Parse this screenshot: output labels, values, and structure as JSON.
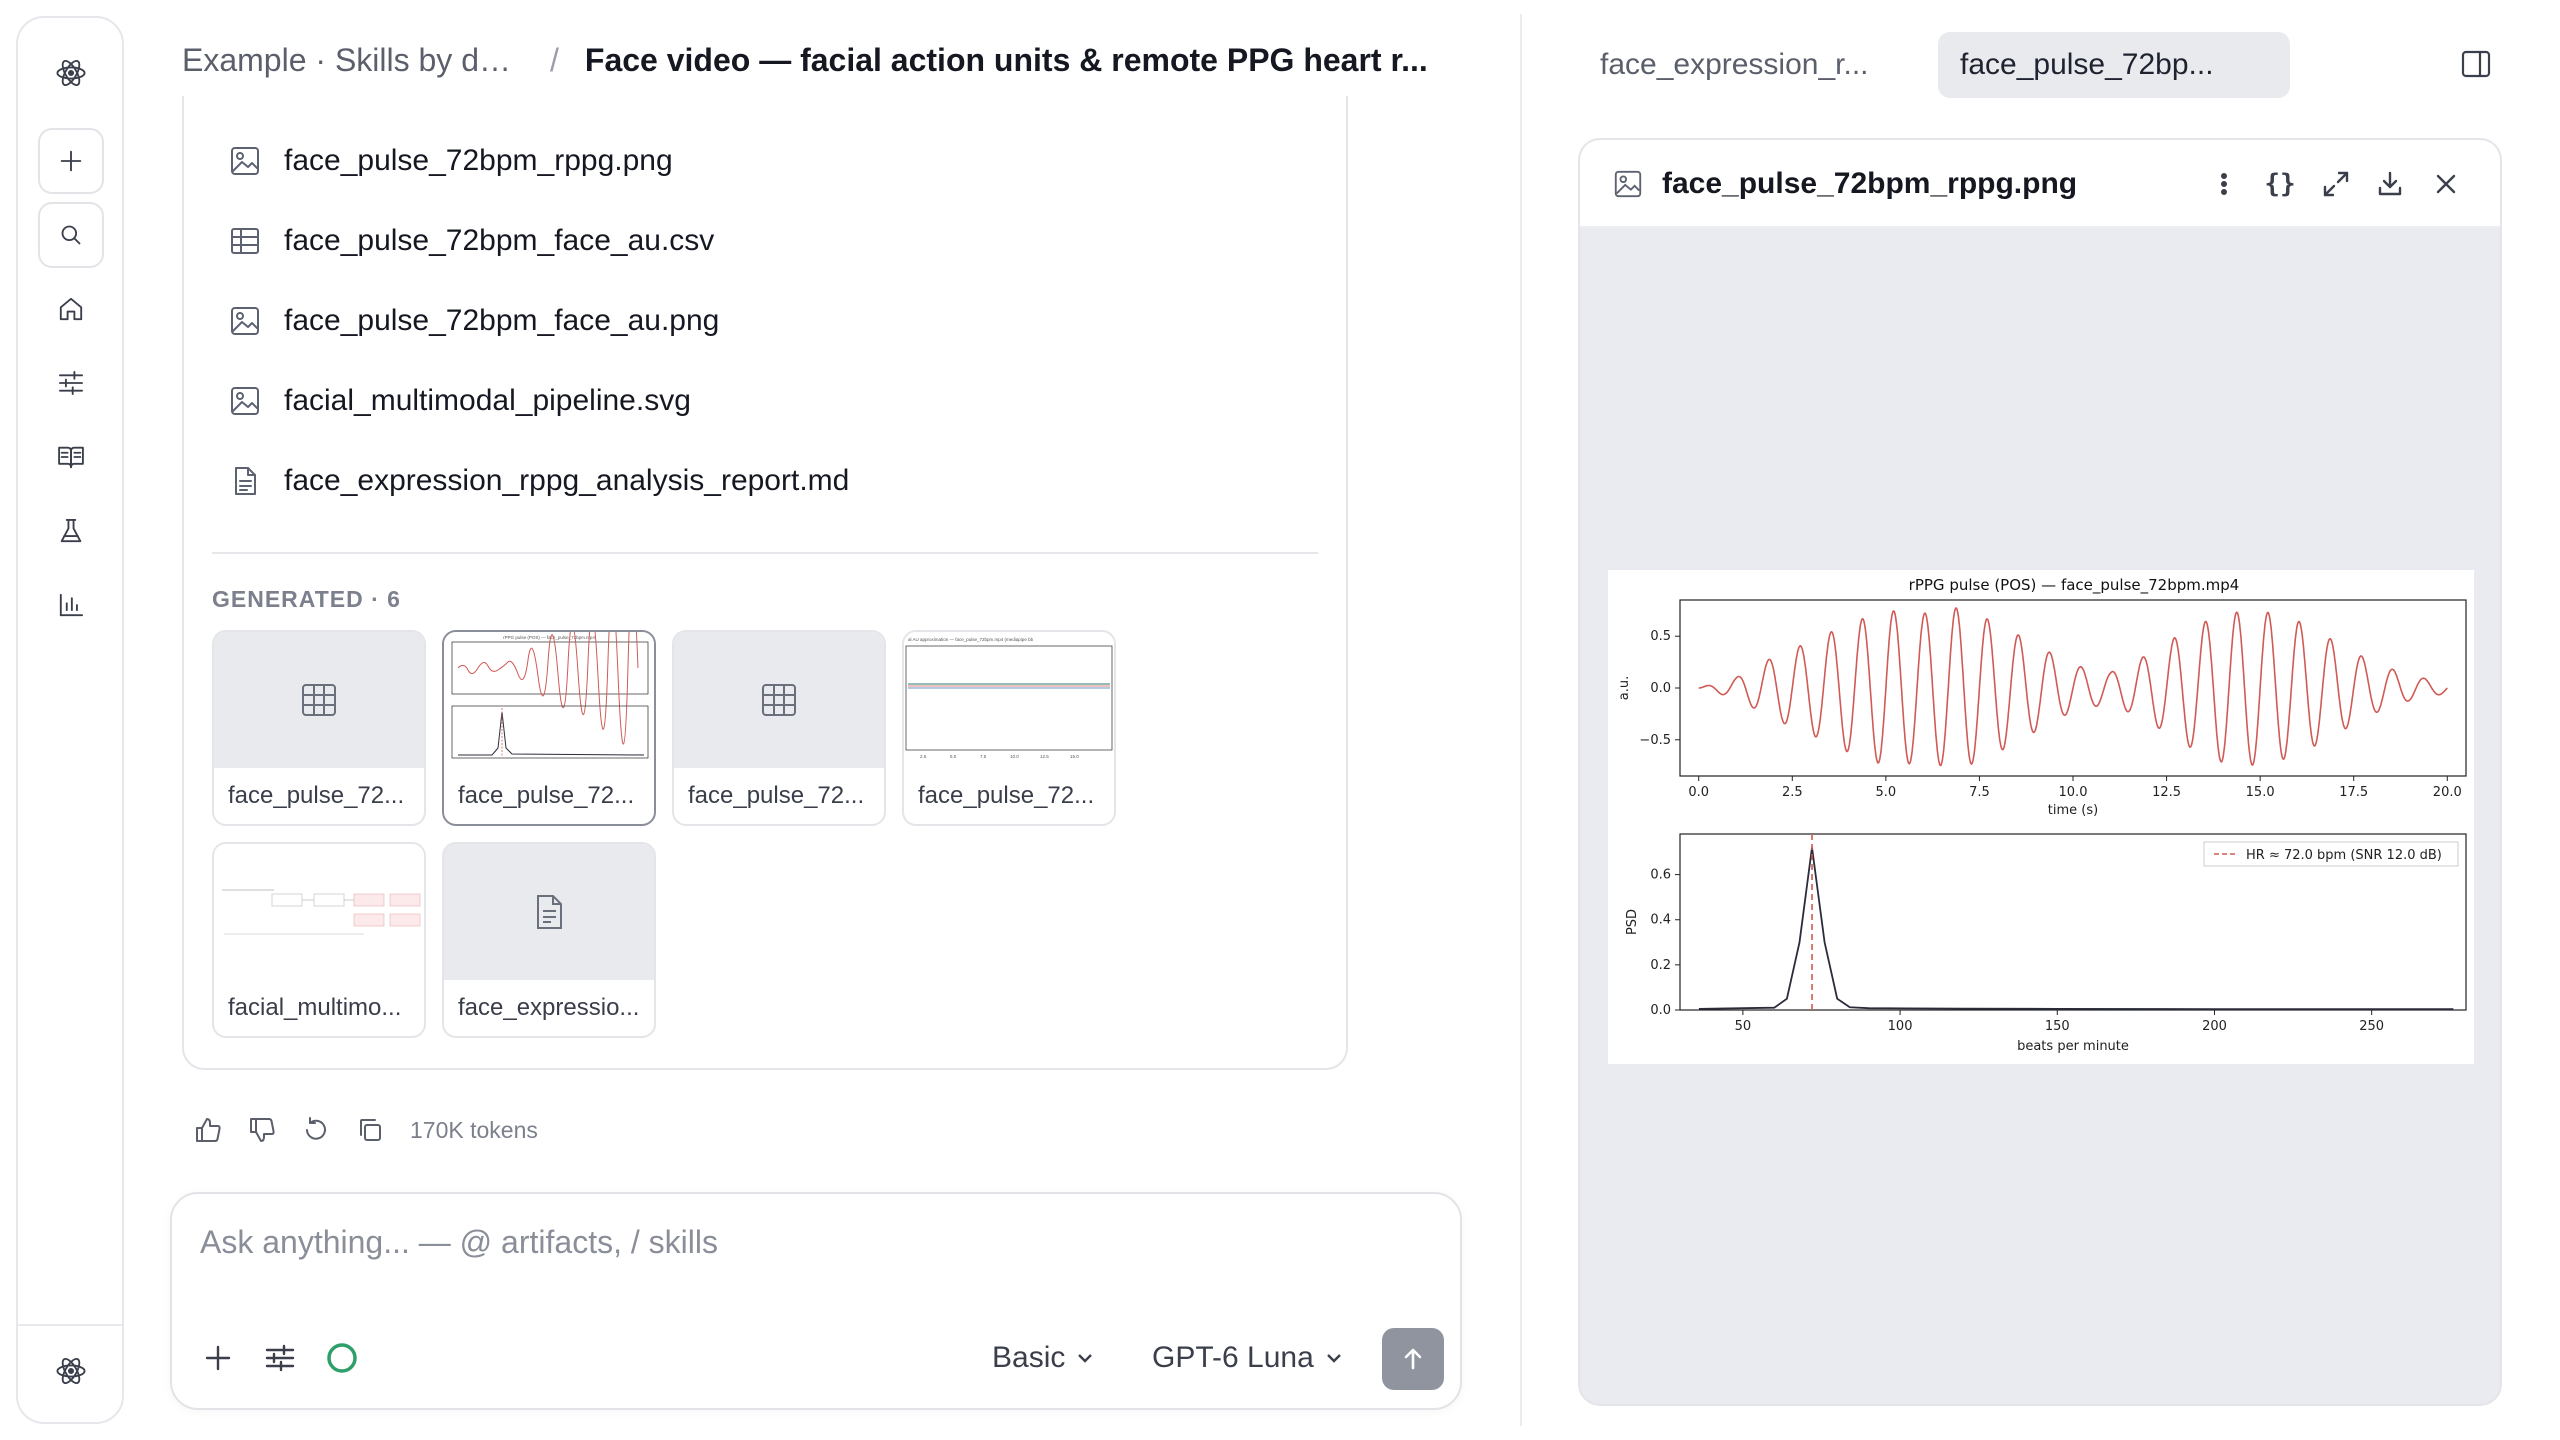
{
  "header": {
    "breadcrumb_parent": "Example · Skills by do...",
    "breadcrumb_separator": "/",
    "title": "Face video — facial action units & remote PPG heart r..."
  },
  "files": [
    {
      "name": "face_pulse_72bpm_rppg.png",
      "icon": "image-icon"
    },
    {
      "name": "face_pulse_72bpm_face_au.csv",
      "icon": "table-icon"
    },
    {
      "name": "face_pulse_72bpm_face_au.png",
      "icon": "image-icon"
    },
    {
      "name": "facial_multimodal_pipeline.svg",
      "icon": "image-icon"
    },
    {
      "name": "face_expression_rppg_analysis_report.md",
      "icon": "document-icon"
    }
  ],
  "generated": {
    "label": "GENERATED · 6",
    "tiles": [
      {
        "name": "face_pulse_72...",
        "thumb": "table-icon"
      },
      {
        "name": "face_pulse_72...",
        "thumb": "chart-preview"
      },
      {
        "name": "face_pulse_72...",
        "thumb": "table-icon"
      },
      {
        "name": "face_pulse_72...",
        "thumb": "chart-preview"
      },
      {
        "name": "facial_multimo...",
        "thumb": "diagram-preview"
      },
      {
        "name": "face_expressio...",
        "thumb": "document-icon"
      }
    ]
  },
  "actions": {
    "tokens": "170K tokens"
  },
  "composer": {
    "placeholder": "Ask anything... — @ artifacts, / skills",
    "mode": "Basic",
    "model": "GPT-6 Luna"
  },
  "right_panel": {
    "tabs": [
      {
        "label": "face_expression_r...",
        "active": false
      },
      {
        "label": "face_pulse_72bp...",
        "active": true
      }
    ],
    "viewer_title": "face_pulse_72bpm_rppg.png",
    "braces_label": "{}"
  },
  "colors": {
    "accent_green": "#2e9e6a",
    "signal_red": "#d05a55",
    "psd_line": "#2a2c3a",
    "send_button": "#8f949e"
  },
  "chart_data": [
    {
      "type": "line",
      "title": "rPPG pulse (POS) — face_pulse_72bpm.mp4",
      "xlabel": "time (s)",
      "ylabel": "a.u.",
      "xlim": [
        -0.5,
        20.5
      ],
      "ylim": [
        -0.85,
        0.85
      ],
      "xticks": [
        "0.0",
        "2.5",
        "5.0",
        "7.5",
        "10.0",
        "12.5",
        "15.0",
        "17.5",
        "20.0"
      ],
      "yticks": [
        "0.5",
        "0.0",
        "−0.5"
      ],
      "series": [
        {
          "color": "#d05a55",
          "freq_hz": 1.2,
          "x_range": [
            0,
            20
          ],
          "envelope": [
            [
              0,
              0.0
            ],
            [
              1,
              0.1
            ],
            [
              2,
              0.3
            ],
            [
              3,
              0.45
            ],
            [
              4,
              0.62
            ],
            [
              5,
              0.75
            ],
            [
              6,
              0.72
            ],
            [
              7,
              0.78
            ],
            [
              8,
              0.62
            ],
            [
              9,
              0.42
            ],
            [
              10,
              0.22
            ],
            [
              11,
              0.15
            ],
            [
              12,
              0.32
            ],
            [
              13,
              0.55
            ],
            [
              14,
              0.72
            ],
            [
              15,
              0.75
            ],
            [
              16,
              0.65
            ],
            [
              17,
              0.45
            ],
            [
              18,
              0.25
            ],
            [
              19,
              0.12
            ],
            [
              20,
              0.05
            ]
          ]
        }
      ]
    },
    {
      "type": "line",
      "xlabel": "beats per minute",
      "ylabel": "PSD",
      "xlim": [
        30,
        280
      ],
      "ylim": [
        0,
        0.78
      ],
      "xticks": [
        "50",
        "100",
        "150",
        "200",
        "250"
      ],
      "yticks": [
        "0.6",
        "0.4",
        "0.2",
        "0.0"
      ],
      "legend": "HR ≈ 72.0 bpm (SNR 12.0 dB)",
      "legend_position": "top-right",
      "hr_marker_bpm": 72,
      "series": [
        {
          "color": "#2a2c3a",
          "points": [
            [
              36,
              0.005
            ],
            [
              50,
              0.008
            ],
            [
              60,
              0.01
            ],
            [
              64,
              0.05
            ],
            [
              68,
              0.3
            ],
            [
              72,
              0.72
            ],
            [
              76,
              0.3
            ],
            [
              80,
              0.05
            ],
            [
              84,
              0.012
            ],
            [
              90,
              0.008
            ],
            [
              120,
              0.006
            ],
            [
              150,
              0.005
            ],
            [
              200,
              0.004
            ],
            [
              250,
              0.004
            ],
            [
              276,
              0.004
            ]
          ]
        }
      ]
    }
  ]
}
